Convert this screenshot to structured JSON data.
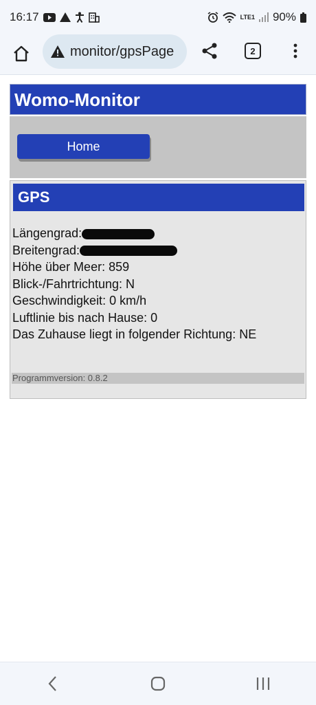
{
  "status_bar": {
    "time": "16:17",
    "battery": "90%",
    "network": "LTE1"
  },
  "browser": {
    "url": "monitor/gpsPage",
    "tab_count": "2"
  },
  "site": {
    "title": "Womo-Monitor",
    "home_button": "Home"
  },
  "gps": {
    "title": "GPS",
    "longitude_label": "Längengrad:",
    "latitude_label": "Breitengrad:",
    "altitude": "Höhe über Meer: 859",
    "heading": "Blick-/Fahrtrichtung: N",
    "speed": "Geschwindigkeit: 0 km/h",
    "distance_home": "Luftlinie bis nach Hause: 0",
    "home_direction": "Das Zuhause liegt in folgender Richtung: NE"
  },
  "footer": {
    "version": "Programmversion: 0.8.2"
  }
}
